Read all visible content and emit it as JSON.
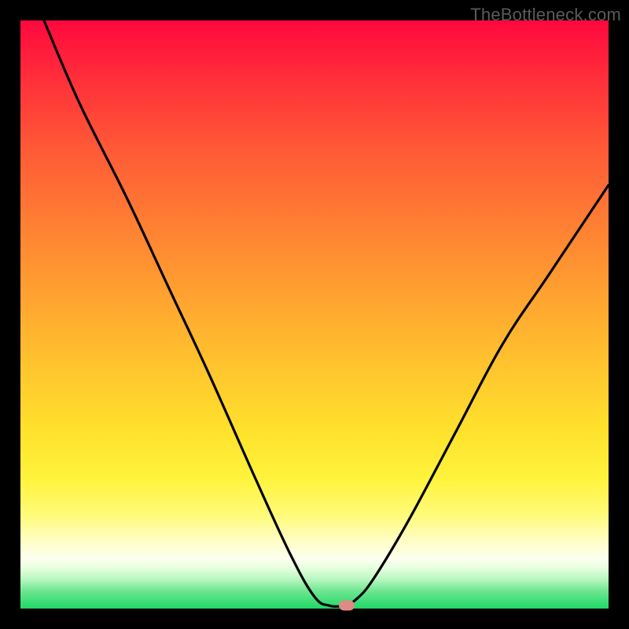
{
  "watermark": "TheBottleneck.com",
  "colors": {
    "frame": "#000000",
    "curve": "#000000",
    "marker": "#e08a85",
    "gradient_top": "#ff083e",
    "gradient_bottom": "#1ed867"
  },
  "chart_data": {
    "type": "line",
    "title": "",
    "xlabel": "",
    "ylabel": "",
    "xlim": [
      0,
      100
    ],
    "ylim": [
      0,
      100
    ],
    "grid": false,
    "legend": false,
    "series": [
      {
        "name": "bottleneck-curve",
        "x": [
          4,
          10,
          18,
          25,
          32,
          40,
          46,
          50,
          52.5,
          55,
          57,
          60,
          66,
          74,
          82,
          90,
          100
        ],
        "y": [
          100,
          86,
          70,
          55,
          40,
          22,
          9,
          2,
          0.5,
          0.5,
          1.5,
          5,
          15,
          30,
          45,
          57,
          72
        ]
      }
    ],
    "marker": {
      "x": 55.5,
      "y": 0.5
    },
    "notes": "y is visual height (0=bottom,100=top); values estimated from pixels"
  }
}
